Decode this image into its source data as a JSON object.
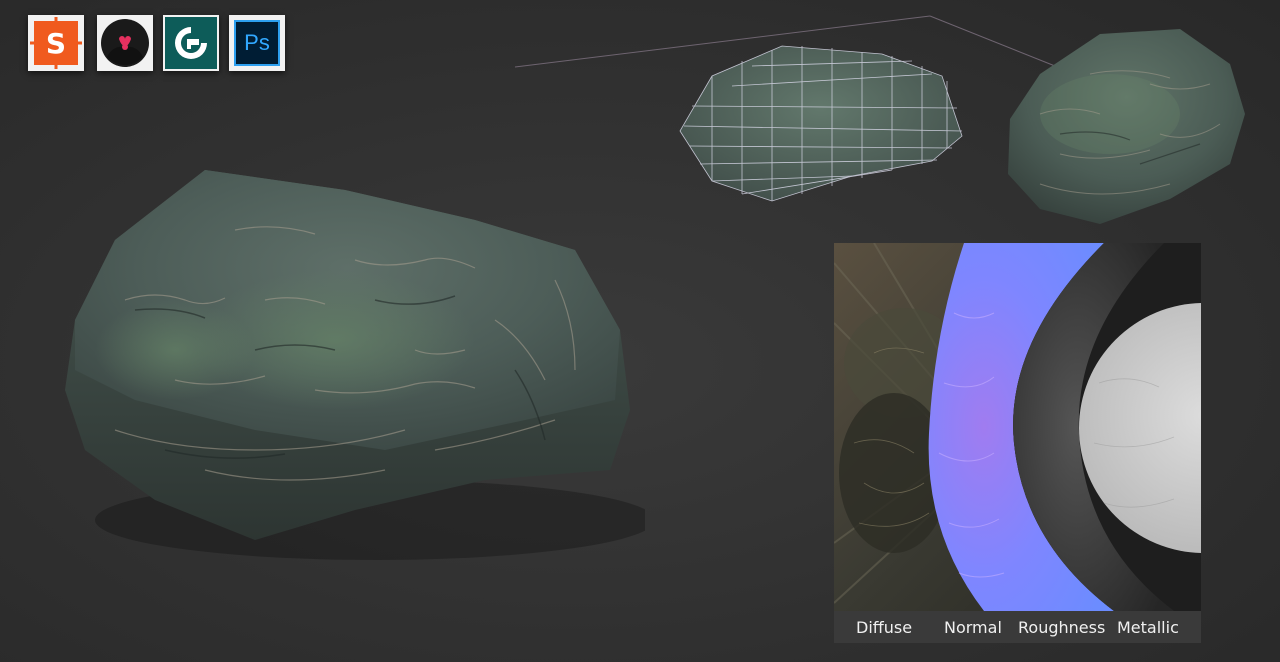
{
  "toolbar": {
    "icons": [
      {
        "name": "substance-painter-icon",
        "label": "S",
        "color": "#f05a1e"
      },
      {
        "name": "marmoset-icon",
        "color": "#1a1a1a"
      },
      {
        "name": "3ds-max-icon",
        "color": "#0d5c59"
      },
      {
        "name": "photoshop-icon",
        "label": "Ps",
        "color": "#31a8ff"
      }
    ]
  },
  "maps": {
    "labels": [
      "Diffuse",
      "Normal",
      "Roughness",
      "Metallic"
    ]
  },
  "colors": {
    "background": "#2f2f2f",
    "rock_base": "#4f6259",
    "rock_moss": "#5a7a5e",
    "normal_map": "#8080ff",
    "label_bar": "#3a3a3a"
  }
}
